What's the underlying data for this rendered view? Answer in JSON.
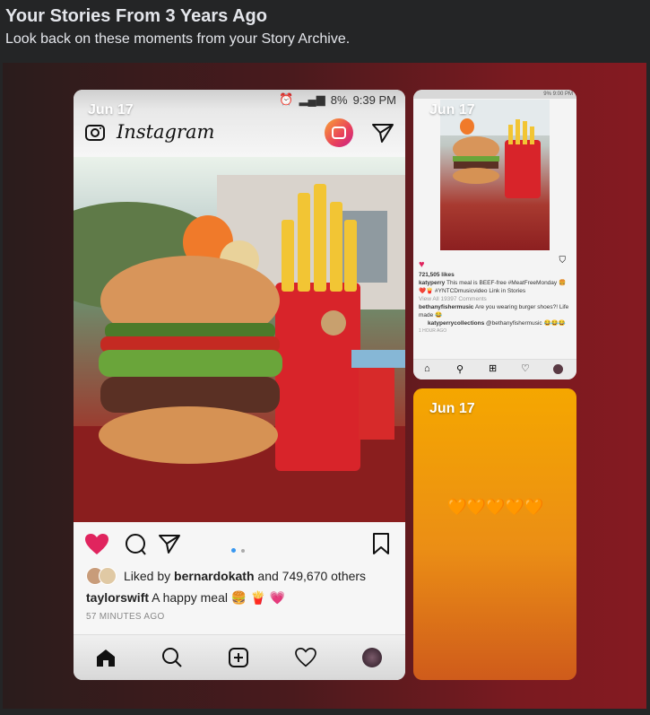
{
  "header": {
    "title": "Your Stories From 3 Years Ago",
    "subtitle": "Look back on these moments from your Story Archive."
  },
  "stories": [
    {
      "date": "Jun 17",
      "status": {
        "battery": "8%",
        "time": "9:39 PM"
      },
      "app_name": "Instagram",
      "post": {
        "liked_by_text": "Liked by",
        "liked_by_user": "bernardokath",
        "liked_by_rest": "and 749,670 others",
        "username": "taylorswift",
        "caption": "A happy meal 🍔 🍟 💗",
        "time_ago": "57 MINUTES AGO"
      }
    },
    {
      "date": "Jun 17",
      "status": {
        "battery": "9%",
        "time": "9:00 PM"
      },
      "post": {
        "likes": "721,505 likes",
        "username": "katyperry",
        "caption": "This meal is BEEF-free #MeatFreeMonday 🍔❤️🍟 #YNTCDmusicvideo Link in Stories",
        "view_all": "View All 19397 Comments",
        "comment1_user": "bethanyfishermusic",
        "comment1": "Are you wearing burger shoes?! Life made 😂",
        "comment2_user": "katyperrycollections",
        "comment2": "@bethanyfishermusic 😂😂😂",
        "time_ago": "1 HOUR AGO"
      }
    },
    {
      "date": "Jun 17",
      "text": "🧡🧡🧡🧡🧡"
    }
  ],
  "colors": {
    "panel_left": "#2a1c1c",
    "panel_right": "#851a21",
    "orange_top": "#f5a700",
    "heart_red": "#e0245e"
  }
}
